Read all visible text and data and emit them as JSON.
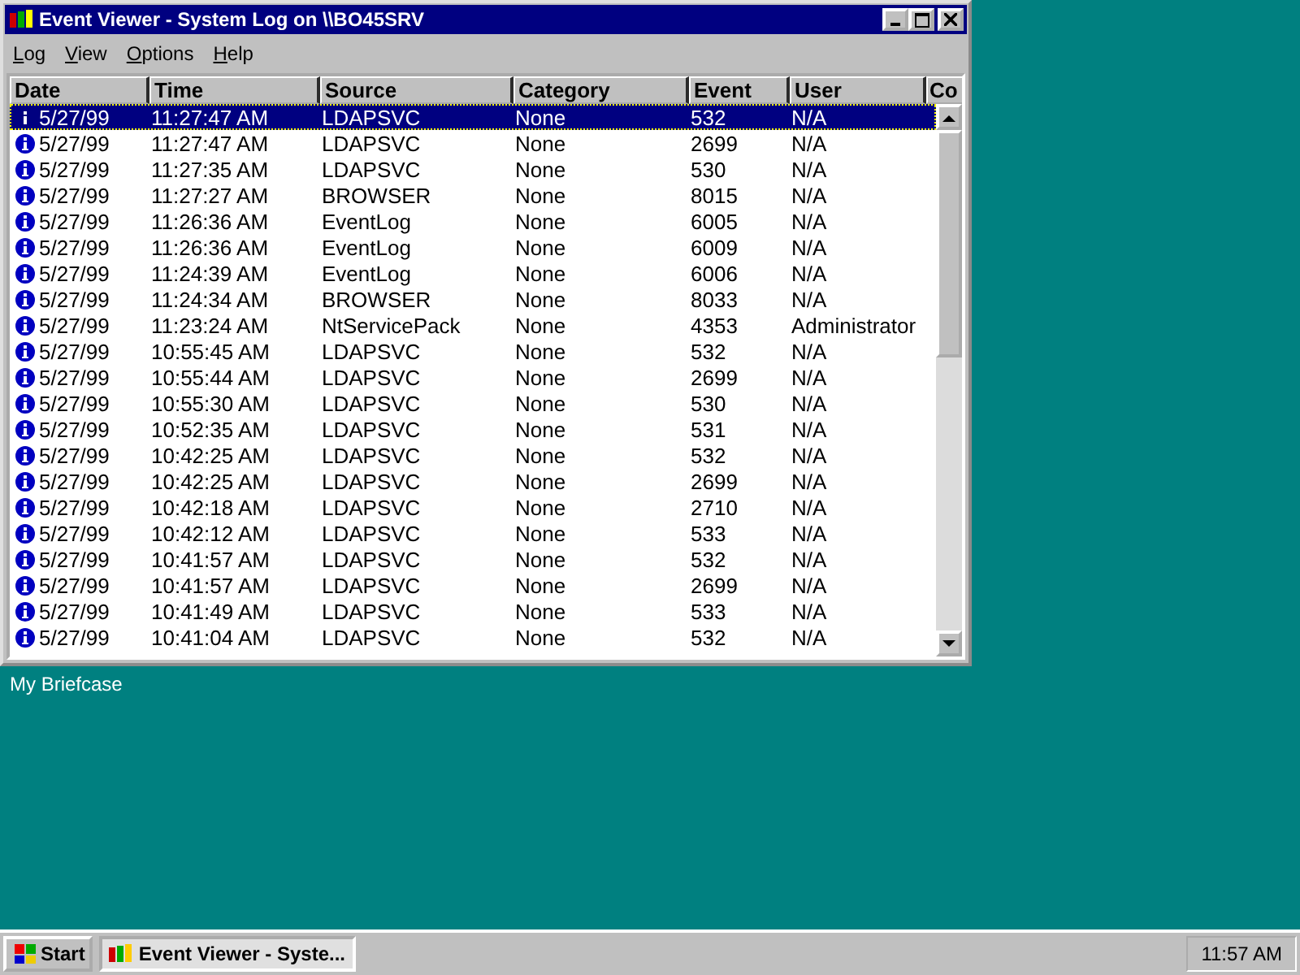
{
  "window": {
    "title": "Event Viewer - System Log on \\\\BO45SRV"
  },
  "menu": [
    {
      "label": "Log"
    },
    {
      "label": "View"
    },
    {
      "label": "Options"
    },
    {
      "label": "Help"
    }
  ],
  "table": {
    "columns": [
      "Date",
      "Time",
      "Source",
      "Category",
      "Event",
      "User",
      "Co"
    ],
    "rows": [
      {
        "date": "5/27/99",
        "time": "11:27:47 AM",
        "source": "LDAPSVC",
        "category": "None",
        "event": "532",
        "user": "N/A",
        "selected": true
      },
      {
        "date": "5/27/99",
        "time": "11:27:47 AM",
        "source": "LDAPSVC",
        "category": "None",
        "event": "2699",
        "user": "N/A",
        "selected": false
      },
      {
        "date": "5/27/99",
        "time": "11:27:35 AM",
        "source": "LDAPSVC",
        "category": "None",
        "event": "530",
        "user": "N/A",
        "selected": false
      },
      {
        "date": "5/27/99",
        "time": "11:27:27 AM",
        "source": "BROWSER",
        "category": "None",
        "event": "8015",
        "user": "N/A",
        "selected": false
      },
      {
        "date": "5/27/99",
        "time": "11:26:36 AM",
        "source": "EventLog",
        "category": "None",
        "event": "6005",
        "user": "N/A",
        "selected": false
      },
      {
        "date": "5/27/99",
        "time": "11:26:36 AM",
        "source": "EventLog",
        "category": "None",
        "event": "6009",
        "user": "N/A",
        "selected": false
      },
      {
        "date": "5/27/99",
        "time": "11:24:39 AM",
        "source": "EventLog",
        "category": "None",
        "event": "6006",
        "user": "N/A",
        "selected": false
      },
      {
        "date": "5/27/99",
        "time": "11:24:34 AM",
        "source": "BROWSER",
        "category": "None",
        "event": "8033",
        "user": "N/A",
        "selected": false
      },
      {
        "date": "5/27/99",
        "time": "11:23:24 AM",
        "source": "NtServicePack",
        "category": "None",
        "event": "4353",
        "user": "Administrator",
        "selected": false
      },
      {
        "date": "5/27/99",
        "time": "10:55:45 AM",
        "source": "LDAPSVC",
        "category": "None",
        "event": "532",
        "user": "N/A",
        "selected": false
      },
      {
        "date": "5/27/99",
        "time": "10:55:44 AM",
        "source": "LDAPSVC",
        "category": "None",
        "event": "2699",
        "user": "N/A",
        "selected": false
      },
      {
        "date": "5/27/99",
        "time": "10:55:30 AM",
        "source": "LDAPSVC",
        "category": "None",
        "event": "530",
        "user": "N/A",
        "selected": false
      },
      {
        "date": "5/27/99",
        "time": "10:52:35 AM",
        "source": "LDAPSVC",
        "category": "None",
        "event": "531",
        "user": "N/A",
        "selected": false
      },
      {
        "date": "5/27/99",
        "time": "10:42:25 AM",
        "source": "LDAPSVC",
        "category": "None",
        "event": "532",
        "user": "N/A",
        "selected": false
      },
      {
        "date": "5/27/99",
        "time": "10:42:25 AM",
        "source": "LDAPSVC",
        "category": "None",
        "event": "2699",
        "user": "N/A",
        "selected": false
      },
      {
        "date": "5/27/99",
        "time": "10:42:18 AM",
        "source": "LDAPSVC",
        "category": "None",
        "event": "2710",
        "user": "N/A",
        "selected": false
      },
      {
        "date": "5/27/99",
        "time": "10:42:12 AM",
        "source": "LDAPSVC",
        "category": "None",
        "event": "533",
        "user": "N/A",
        "selected": false
      },
      {
        "date": "5/27/99",
        "time": "10:41:57 AM",
        "source": "LDAPSVC",
        "category": "None",
        "event": "532",
        "user": "N/A",
        "selected": false
      },
      {
        "date": "5/27/99",
        "time": "10:41:57 AM",
        "source": "LDAPSVC",
        "category": "None",
        "event": "2699",
        "user": "N/A",
        "selected": false
      },
      {
        "date": "5/27/99",
        "time": "10:41:49 AM",
        "source": "LDAPSVC",
        "category": "None",
        "event": "533",
        "user": "N/A",
        "selected": false
      },
      {
        "date": "5/27/99",
        "time": "10:41:04 AM",
        "source": "LDAPSVC",
        "category": "None",
        "event": "532",
        "user": "N/A",
        "selected": false
      }
    ]
  },
  "desktop": {
    "icon_label": "My Briefcase"
  },
  "taskbar": {
    "start": "Start",
    "tasks": [
      {
        "label": "Event Viewer - Syste...",
        "selected": true
      }
    ],
    "clock": "11:57 AM"
  }
}
